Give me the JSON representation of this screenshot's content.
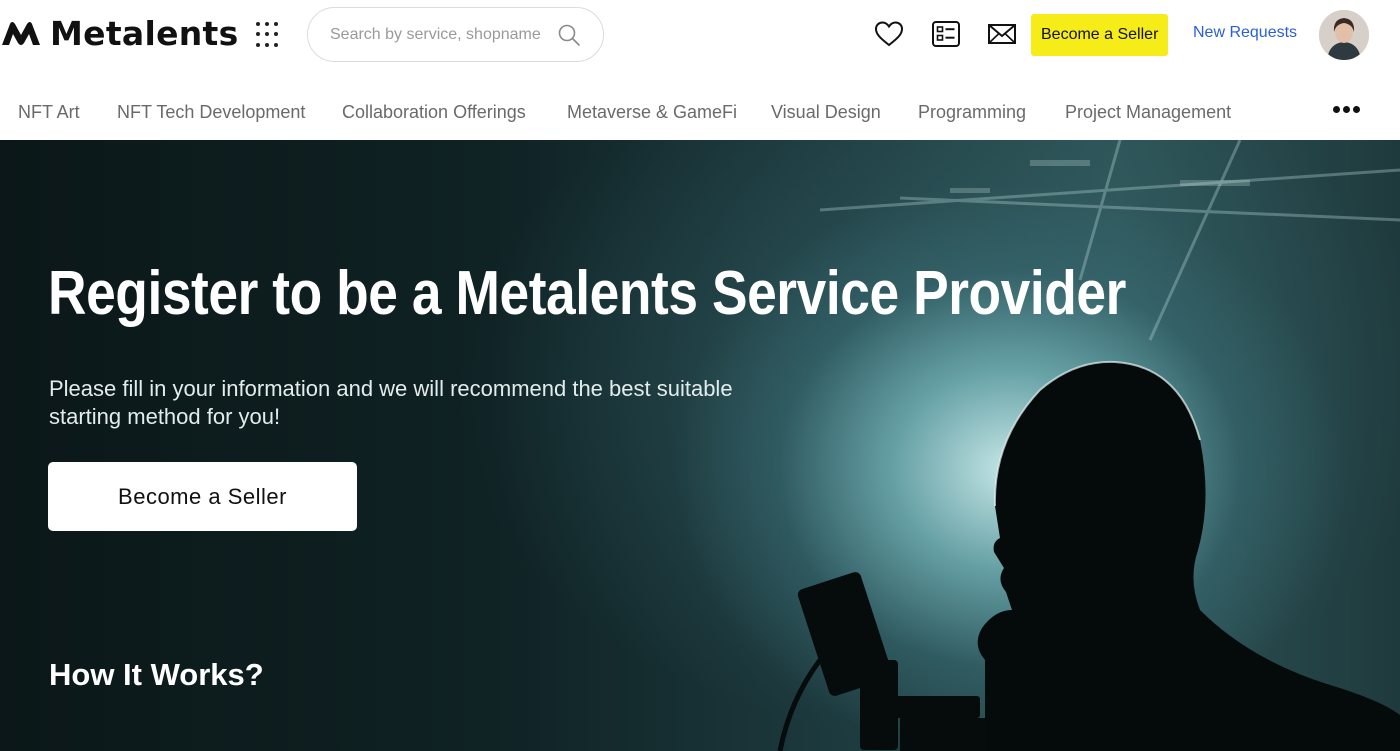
{
  "header": {
    "logo_text": "Metalents",
    "search_placeholder": "Search by service, shopname",
    "become_seller_label": "Become a Seller",
    "new_requests_label": "New Requests",
    "icons": [
      "heart-icon",
      "order-list-icon",
      "mail-icon",
      "search-icon",
      "apps-grid-icon"
    ],
    "highlight_color": "#f5ec18",
    "link_color": "#2a5fd6"
  },
  "categories": [
    "NFT Art",
    "NFT Tech Development",
    "Collaboration Offerings",
    "Metaverse & GameFi",
    "Visual Design",
    "Programming",
    "Project Management"
  ],
  "hero": {
    "title": "Register to be a Metalents Service Provider",
    "subtitle": "Please fill in your information and we will recommend the best suitable starting method for you!",
    "button_label": "Become a Seller",
    "section_heading": "How It Works?"
  }
}
